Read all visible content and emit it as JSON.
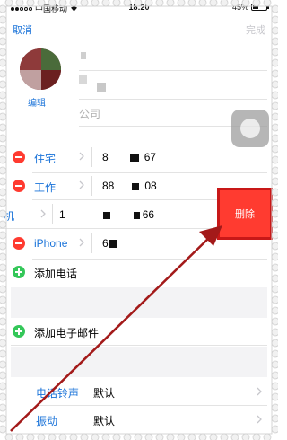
{
  "status": {
    "carrier": "中国移动",
    "time": "18:20",
    "battery": "45%",
    "battery_level": 0.45
  },
  "nav": {
    "cancel": "取消",
    "done": "完成"
  },
  "contact": {
    "edit_photo": "编辑",
    "company_placeholder": "公司"
  },
  "phones": [
    {
      "label": "住宅",
      "value_start": "8",
      "value_end": "67"
    },
    {
      "label": "工作",
      "value_start": "88",
      "value_end": "08"
    },
    {
      "label": "机",
      "value_start": "1",
      "value_end": "66"
    },
    {
      "label": "iPhone",
      "value_start": "6",
      "value_end": ""
    }
  ],
  "delete_label": "删除",
  "add_phone": "添加电话",
  "add_email": "添加电子邮件",
  "settings": [
    {
      "label": "电话铃声",
      "value": "默认"
    },
    {
      "label": "振动",
      "value": "默认"
    }
  ],
  "colors": {
    "accent_blue": "#1a73d9",
    "delete_red": "#ff3b30",
    "add_green": "#34c759",
    "annotation_arrow": "#a31a1a"
  }
}
